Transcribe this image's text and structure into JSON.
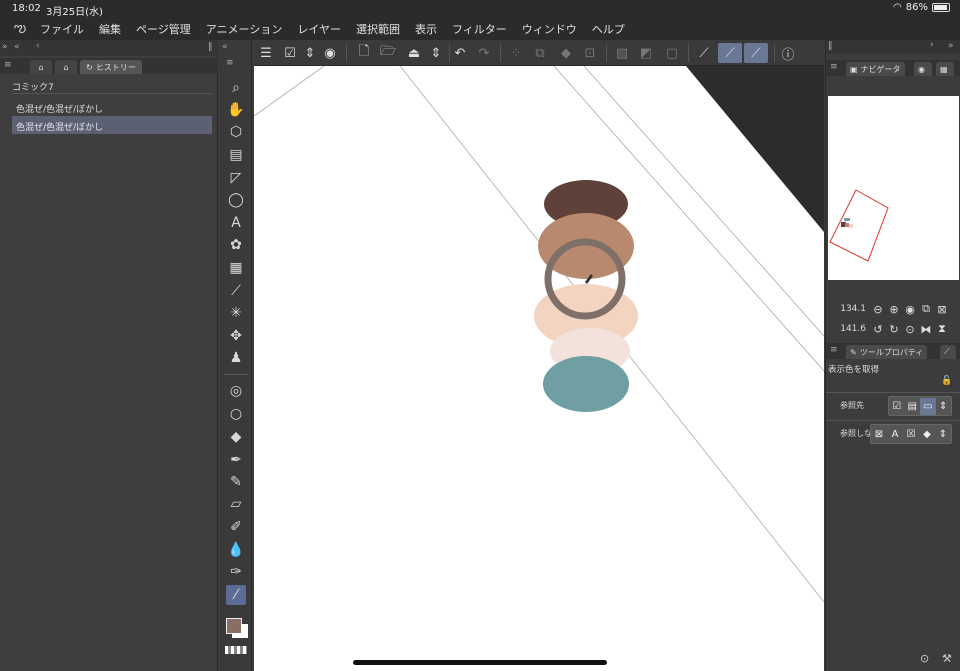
{
  "status": {
    "time": "18:02",
    "date": "3月25日(水)",
    "battery": "86%"
  },
  "menu": [
    "ファイル",
    "編集",
    "ページ管理",
    "アニメーション",
    "レイヤー",
    "選択範囲",
    "表示",
    "フィルター",
    "ウィンドウ",
    "ヘルプ"
  ],
  "left_panel": {
    "tab_label": "ヒストリー",
    "title": "コミック7",
    "items": [
      "色混ぜ/色混ぜ/ぼかし",
      "色混ぜ/色混ぜ/ぼかし"
    ],
    "selected_index": 1
  },
  "right_panel": {
    "navigator_tab": "ナビゲータ",
    "zoom": "134.1",
    "rotation": "141.6",
    "tool_property_tab": "ツールプロパティ",
    "tool_name": "表示色を取得",
    "reference_label": "参照先",
    "not_reference_label": "参照しな"
  },
  "colors": {
    "main_color": "#8a6e64",
    "sub_color": "#ffffff",
    "accent": "#6a7896",
    "swatches": [
      "#5e4138",
      "#b8896f",
      "#f2d4c0",
      "#f3e2dc",
      "#6f9ea3"
    ]
  },
  "icons": {
    "tools": [
      "search-icon",
      "hand-icon",
      "object-icon",
      "layout-icon",
      "ruler-icon",
      "lasso-icon",
      "text-icon",
      "gear-icon",
      "gradient-icon",
      "brush-icon",
      "sparkle-icon",
      "move-icon",
      "figure-icon",
      "lasso-icon",
      "lasso-icon",
      "fill-icon",
      "pen-icon",
      "pencil-icon",
      "eraser-icon",
      "pen-icon",
      "blend-icon",
      "pen-icon",
      "eyedropper-icon"
    ]
  }
}
